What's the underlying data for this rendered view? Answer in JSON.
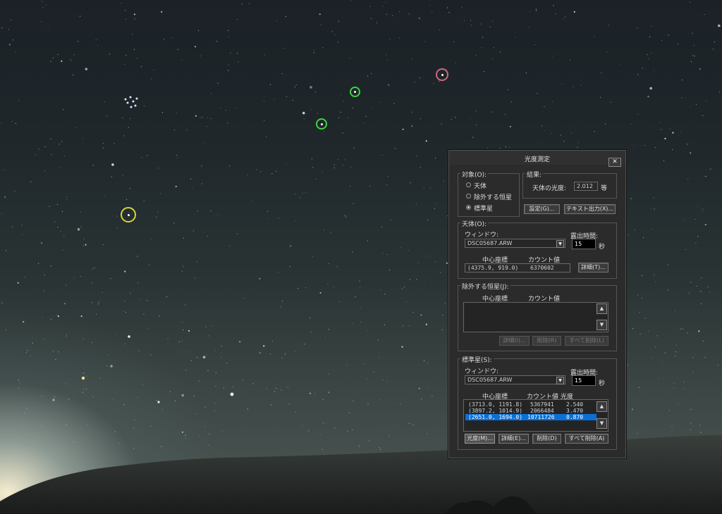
{
  "dialog": {
    "title": "光度測定",
    "close_glyph": "✕",
    "target_group": {
      "label": "対象(O):",
      "options": [
        "天体",
        "除外する恒星",
        "標準星"
      ],
      "selected": "標準星"
    },
    "result_group": {
      "label": "結果:",
      "magnitude_label": "天体の光度:",
      "magnitude_value": "2.012",
      "magnitude_unit": "等",
      "settings_button": "設定(G)...",
      "text_output_button": "テキスト出力(X)..."
    },
    "object_group": {
      "label": "天体(O):",
      "window_label": "ウィンドウ:",
      "window_value": "DSC05687.ARW",
      "exposure_label": "露出時間:",
      "exposure_value": "15",
      "exposure_unit": "秒",
      "center_header": "中心座標",
      "count_header": "カウント値",
      "center_value": "(4375.9,  919.0)",
      "count_value": "6370602",
      "detail_button": "詳細(T)..."
    },
    "exclude_group": {
      "label": "除外する恒星(J):",
      "center_header": "中心座標",
      "count_header": "カウント値",
      "detail_button": "詳細(I)...",
      "delete_button": "削除(R)",
      "delete_all_button": "すべて削除(L)"
    },
    "standard_group": {
      "label": "標準星(S):",
      "window_label": "ウィンドウ:",
      "window_value": "DSC05687.ARW",
      "exposure_label": "露出時間:",
      "exposure_value": "15",
      "exposure_unit": "秒",
      "center_header": "中心座標",
      "count_header": "カウント値",
      "mag_header": "光度",
      "rows": [
        {
          "center": "(3713.0, 1191.8)",
          "count": "5367941",
          "mag": "2.540",
          "selected": false
        },
        {
          "center": "(3897.2, 1014.9)",
          "count": "2066484",
          "mag": "3.470",
          "selected": false
        },
        {
          "center": "(2651.0, 1694.0)",
          "count": "10711726",
          "mag": "0.870",
          "selected": true
        }
      ],
      "magnitude_button": "光度(M)...",
      "detail_button": "詳細(E)...",
      "delete_button": "削除(D)",
      "delete_all_button": "すべて削除(A)"
    },
    "scroll_up": "▲",
    "scroll_down": "▼",
    "combo_arrow": "▼"
  },
  "image_markers": [
    {
      "color": "#c86a7a",
      "kind": "target"
    },
    {
      "color": "#3dd63d",
      "kind": "standard"
    },
    {
      "color": "#3dd63d",
      "kind": "standard"
    },
    {
      "color": "#d4d43a",
      "kind": "standard-selected"
    }
  ]
}
